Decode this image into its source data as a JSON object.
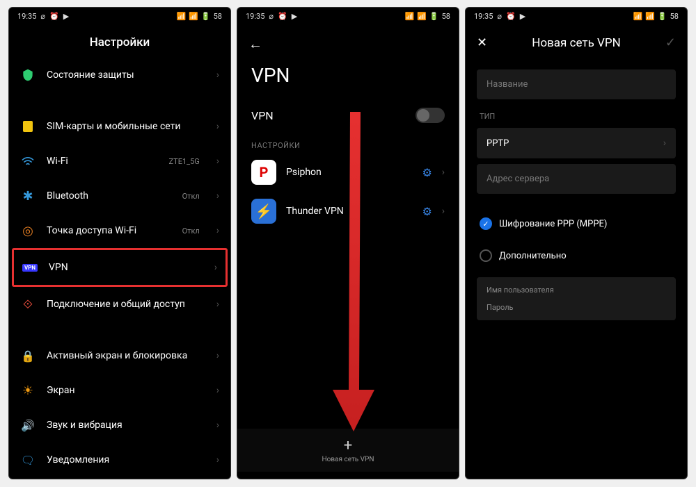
{
  "status": {
    "time": "19:35",
    "battery": "58"
  },
  "screen1": {
    "title": "Настройки",
    "items": [
      {
        "label": "Состояние защиты",
        "icon": "shield",
        "color": "#2ecc71"
      },
      {
        "label": "SIM-карты и мобильные сети",
        "icon": "sim",
        "color": "#f1c40f"
      },
      {
        "label": "Wi-Fi",
        "icon": "wifi",
        "color": "#3498db",
        "sub": "ZTE1_5G"
      },
      {
        "label": "Bluetooth",
        "icon": "bluetooth",
        "color": "#3498db",
        "sub": "Откл"
      },
      {
        "label": "Точка доступа Wi-Fi",
        "icon": "hotspot",
        "color": "#e67e22",
        "sub": "Откл"
      },
      {
        "label": "VPN",
        "icon": "vpn",
        "highlighted": true
      },
      {
        "label": "Подключение и общий доступ",
        "icon": "share",
        "color": "#e74c3c"
      },
      {
        "label": "Активный экран и блокировка",
        "icon": "lock",
        "color": "#e74c3c"
      },
      {
        "label": "Экран",
        "icon": "brightness",
        "color": "#f39c12"
      },
      {
        "label": "Звук и вибрация",
        "icon": "sound",
        "color": "#2ecc71"
      },
      {
        "label": "Уведомления",
        "icon": "notification",
        "color": "#3498db"
      }
    ]
  },
  "screen2": {
    "big_title": "VPN",
    "toggle_label": "VPN",
    "section_label": "НАСТРОЙКИ",
    "apps": [
      {
        "name": "Psiphon",
        "style": "psiphon",
        "letter": "P"
      },
      {
        "name": "Thunder VPN",
        "style": "thunder",
        "letter": "⚡"
      }
    ],
    "bottom_action": "Новая сеть VPN"
  },
  "screen3": {
    "title": "Новая сеть VPN",
    "name_placeholder": "Название",
    "type_label": "ТИП",
    "type_value": "PPTP",
    "server_placeholder": "Адрес сервера",
    "encryption_label": "Шифрование PPP (MPPE)",
    "advanced_label": "Дополнительно",
    "username_label": "Имя пользователя",
    "password_label": "Пароль"
  }
}
